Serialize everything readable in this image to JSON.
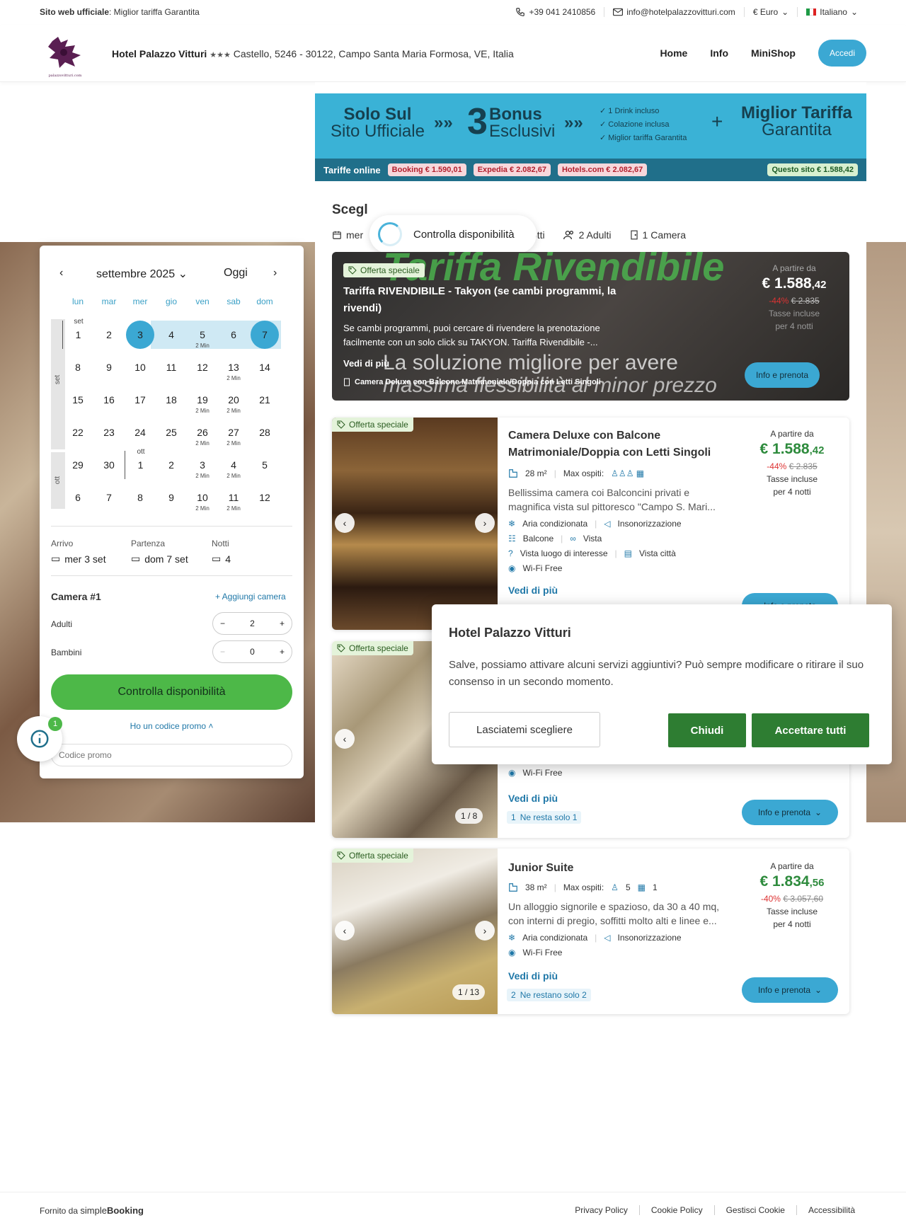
{
  "topbar": {
    "official_label": "Sito web ufficiale",
    "official_text": ": Miglior tariffa Garantita",
    "phone": "+39 041 2410856",
    "email": "info@hotelpalazzovitturi.com",
    "currency": "€ Euro",
    "language": "Italiano"
  },
  "header": {
    "hotel_name": "Hotel Palazzo Vitturi",
    "stars": "★★★",
    "address": "Castello, 5246 - 30122, Campo Santa Maria Formosa, VE, Italia",
    "logo_caption": "palazzovitturi.com",
    "nav": [
      "Home",
      "Info",
      "MiniShop"
    ],
    "login": "Accedi"
  },
  "banner": {
    "only_big": "Solo Sul",
    "only_small": "Sito Ufficiale",
    "arrows": "»»",
    "three": "3",
    "bonus_big": "Bonus",
    "bonus_small": "Esclusivi",
    "list": [
      "✓ 1 Drink incluso",
      "✓ Colazione inclusa",
      "✓ Miglior tariffa Garantita"
    ],
    "plus": "+",
    "best_big": "Miglior Tariffa",
    "best_small": "Garantita",
    "rates_label": "Tariffe online",
    "rates": [
      "Booking € 1.590,01",
      "Expedia € 2.082,67",
      "Hotels.com € 2.082,67"
    ],
    "this_site": "Questo sito  € 1.588,42"
  },
  "search": {
    "title": "Scegl",
    "date": "mer",
    "nights": "4 Notti",
    "adults": "2 Adulti",
    "rooms": "1 Camera",
    "loading": "Controlla disponibilità"
  },
  "calendar": {
    "month": "settembre 2025",
    "today": "Oggi",
    "dow": [
      "lun",
      "mar",
      "mer",
      "gio",
      "ven",
      "sab",
      "dom"
    ],
    "side_set": "set",
    "side_ott": "ott",
    "weeks": [
      [
        {
          "d": "1",
          "m": "set"
        },
        {
          "d": "2"
        },
        {
          "d": "3",
          "sel": true
        },
        {
          "d": "4"
        },
        {
          "d": "5",
          "n": "2 Min"
        },
        {
          "d": "6"
        },
        {
          "d": "7",
          "sel": true
        }
      ],
      [
        {
          "d": "8"
        },
        {
          "d": "9"
        },
        {
          "d": "10"
        },
        {
          "d": "11"
        },
        {
          "d": "12"
        },
        {
          "d": "13",
          "n": "2 Min"
        },
        {
          "d": "14"
        }
      ],
      [
        {
          "d": "15"
        },
        {
          "d": "16"
        },
        {
          "d": "17"
        },
        {
          "d": "18"
        },
        {
          "d": "19",
          "n": "2 Min"
        },
        {
          "d": "20",
          "n": "2 Min"
        },
        {
          "d": "21"
        }
      ],
      [
        {
          "d": "22"
        },
        {
          "d": "23"
        },
        {
          "d": "24"
        },
        {
          "d": "25"
        },
        {
          "d": "26",
          "n": "2 Min"
        },
        {
          "d": "27",
          "n": "2 Min"
        },
        {
          "d": "28"
        }
      ],
      [
        {
          "d": "29"
        },
        {
          "d": "30"
        },
        {
          "d": "1",
          "m": "ott"
        },
        {
          "d": "2"
        },
        {
          "d": "3",
          "n": "2 Min"
        },
        {
          "d": "4",
          "n": "2 Min"
        },
        {
          "d": "5"
        }
      ],
      [
        {
          "d": "6"
        },
        {
          "d": "7"
        },
        {
          "d": "8"
        },
        {
          "d": "9"
        },
        {
          "d": "10",
          "n": "2 Min"
        },
        {
          "d": "11",
          "n": "2 Min"
        },
        {
          "d": "12"
        }
      ]
    ]
  },
  "stay": {
    "arrival_label": "Arrivo",
    "arrival": "mer 3 set",
    "departure_label": "Partenza",
    "departure": "dom 7 set",
    "nights_label": "Notti",
    "nights": "4",
    "room_label": "Camera #1",
    "add_room": "+ Aggiungi camera",
    "adults_label": "Adulti",
    "adults": "2",
    "children_label": "Bambini",
    "children": "0",
    "check_button": "Controlla disponibilità",
    "promo_link": "Ho un codice promo",
    "promo_placeholder": "Codice promo",
    "info_badge": "1"
  },
  "offer_special": "Offerta speciale",
  "from_label": "A partire da",
  "taxes": "Tasse incluse",
  "per_nights": "per 4 notti",
  "more": "Vedi di più",
  "info_book": "Info e prenota",
  "resell": {
    "bg_big": "Tariffa Rivendibile",
    "bg_line1": "La soluzione migliore per avere",
    "bg_line2": "massima flessibilità al minor prezzo",
    "title": "Tariffa RIVENDIBILE - Takyon (se cambi programmi, la rivendi)",
    "desc": "Se cambi programmi, puoi cercare di rivendere la prenotazione facilmente con un solo click su TAKYON. Tariffa Rivendibile -...",
    "room": "Camera Deluxe con Balcone Matrimoniale/Doppia con Letti Singoli",
    "price_int": "€ 1.588",
    "price_dec": ",42",
    "pct": "-44%",
    "old": "€ 2.835"
  },
  "room1": {
    "title": "Camera Deluxe con Balcone Matrimoniale/Doppia con Letti Singoli",
    "size": "28 m²",
    "max_guests": "Max ospiti:",
    "desc": "Bellissima camera coi Balconcini privati e magnifica vista sul pittoresco \"Campo S. Mari...",
    "amenities": [
      [
        "Aria condizionata",
        "Insonorizzazione"
      ],
      [
        "Balcone",
        "Vista"
      ],
      [
        "Vista luogo di interesse",
        "Vista città"
      ],
      [
        "Wi-Fi Free"
      ]
    ],
    "price_int": "€ 1.588",
    "price_dec": ",42",
    "pct": "-44%",
    "old": "€ 2.835"
  },
  "room2": {
    "amen": "Wi-Fi Free",
    "img_count": "1 / 8",
    "remaining_n": "1",
    "remaining": "Ne resta solo 1"
  },
  "room3": {
    "title": "Junior Suite",
    "size": "38 m²",
    "max_guests": "Max ospiti:",
    "guests": "5",
    "beds": "1",
    "desc": "Un alloggio signorile e spazioso, da 30 a 40 mq, con interni di pregio, soffitti molto alti e linee e...",
    "amenities": [
      [
        "Aria condizionata",
        "Insonorizzazione"
      ],
      [
        "Wi-Fi Free"
      ]
    ],
    "price_int": "€ 1.834",
    "price_dec": ",56",
    "pct": "-40%",
    "old": "€ 3.057,60",
    "img_count": "1 / 13",
    "remaining_n": "2",
    "remaining": "Ne restano solo 2"
  },
  "cookie": {
    "title": "Hotel Palazzo Vitturi",
    "text": "Salve, possiamo attivare alcuni servizi aggiuntivi? Può sempre modificare o ritirare il suo consenso in un secondo momento.",
    "choose": "Lasciatemi scegliere",
    "close": "Chiudi",
    "accept": "Accettare tutti"
  },
  "footer": {
    "powered": "Fornito da",
    "brand_a": "simple",
    "brand_b": "Booking",
    "links": [
      "Privacy Policy",
      "Cookie Policy",
      "Gestisci Cookie",
      "Accessibilità"
    ]
  },
  "colors": {
    "accent": "#3ba8d3",
    "green": "#4db848",
    "price": "#2e8b3d",
    "banner_dark": "#206f8a"
  }
}
